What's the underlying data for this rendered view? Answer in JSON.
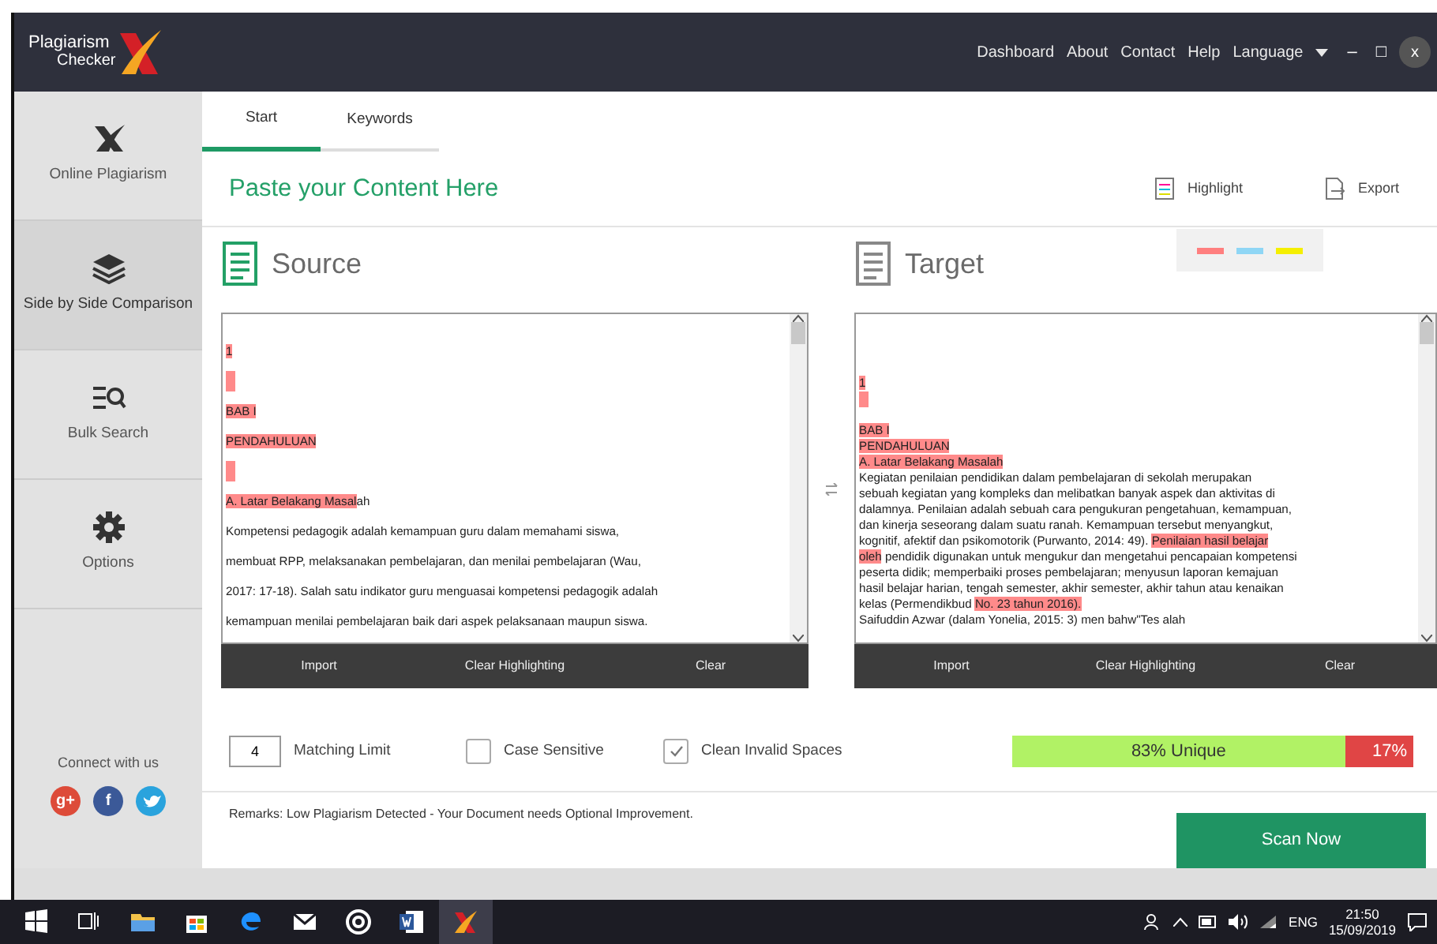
{
  "window": {
    "logo": [
      "Plagiarism",
      "Checker"
    ],
    "nav": [
      "Dashboard",
      "About",
      "Contact",
      "Help",
      "Language"
    ],
    "controls": [
      "–",
      "□",
      "x"
    ]
  },
  "sidebar": {
    "items": [
      {
        "label": "Online Plagiarism",
        "kind": "x",
        "selected": false
      },
      {
        "label": "Side by Side Comparison",
        "kind": "layers",
        "selected": true
      },
      {
        "label": "Bulk Search",
        "kind": "search-list",
        "selected": false
      },
      {
        "label": "Options",
        "kind": "gear",
        "selected": false
      }
    ],
    "connect": "Connect with us",
    "social": [
      {
        "kind": "glyph",
        "glyph": "g+",
        "color": "#dd4b39"
      },
      {
        "kind": "glyph",
        "glyph": "f",
        "color": "#3b5998"
      },
      {
        "kind": "bird",
        "color": "#2aa3dd"
      }
    ]
  },
  "tabs": [
    {
      "label": "Start",
      "selected": true
    },
    {
      "label": "Keywords",
      "selected": false
    }
  ],
  "heading": "Paste your Content Here",
  "tools": [
    "Highlight",
    "Export"
  ],
  "legend": [
    {
      "color": "#ff7f7f"
    },
    {
      "color": "#8fd6f5"
    },
    {
      "color": "#f5ef00"
    }
  ],
  "panels": [
    {
      "title": "Source",
      "kind": "source",
      "buttons": [
        "Import",
        "Clear Highlighting",
        "Clear"
      ],
      "lines": [
        {
          "kind": "text",
          "segments": [
            {
              "text": "1",
              "highlighted": true
            }
          ]
        },
        {
          "kind": "blank",
          "highlighted": true
        },
        {
          "kind": "text",
          "segments": [
            {
              "text": "BAB I ",
              "highlighted": true
            }
          ]
        },
        {
          "kind": "text",
          "segments": [
            {
              "text": "PENDAHULUAN ",
              "highlighted": true
            }
          ]
        },
        {
          "kind": "blank",
          "highlighted": true
        },
        {
          "kind": "text",
          "segments": [
            {
              "text": "A.  Latar Belakang Masal",
              "highlighted": true
            },
            {
              "text": "ah",
              "highlighted": false
            }
          ]
        },
        {
          "kind": "text",
          "segments": [
            {
              "text": "Kompetensi pedagogik adalah kemampuan guru dalam memahami siswa,",
              "highlighted": false
            }
          ]
        },
        {
          "kind": "text",
          "segments": [
            {
              "text": "membuat RPP, melaksanakan pembelajaran, dan menilai pembelajaran (Wau,",
              "highlighted": false
            }
          ]
        },
        {
          "kind": "text",
          "segments": [
            {
              "text": "2017: 17-18). Salah satu indikator guru menguasai kompetensi pedagogik adalah",
              "highlighted": false
            }
          ]
        },
        {
          "kind": "text",
          "segments": [
            {
              "text": "kemampuan menilai pembelajaran baik dari aspek pelaksanaan maupun siswa.",
              "highlighted": false
            }
          ]
        }
      ]
    },
    {
      "title": "Target",
      "kind": "target",
      "buttons": [
        "Import",
        "Clear Highlighting",
        "Clear"
      ],
      "lines": [
        {
          "kind": "text",
          "segments": [
            {
              "text": "1",
              "highlighted": true
            }
          ]
        },
        {
          "kind": "blank",
          "highlighted": true
        },
        {
          "kind": "blank",
          "highlighted": false
        },
        {
          "kind": "text",
          "segments": [
            {
              "text": "BAB I ",
              "highlighted": true
            }
          ]
        },
        {
          "kind": "text",
          "segments": [
            {
              "text": "PENDAHULUAN ",
              "highlighted": true
            }
          ]
        },
        {
          "kind": "text",
          "segments": [
            {
              "text": "A.  Latar Belakang Masalah",
              "highlighted": true
            }
          ]
        },
        {
          "kind": "text",
          "segments": [
            {
              "text": "Kegiatan penilaian pendidikan dalam pembelajaran di sekolah merupakan",
              "highlighted": false
            }
          ]
        },
        {
          "kind": "text",
          "segments": [
            {
              "text": "sebuah kegiatan yang kompleks dan melibatkan banyak aspek dan aktivitas di",
              "highlighted": false
            }
          ]
        },
        {
          "kind": "text",
          "segments": [
            {
              "text": "dalamnya.  Penilaian adalah sebuah cara pengukuran pengetahuan, kemampuan,",
              "highlighted": false
            }
          ]
        },
        {
          "kind": "text",
          "segments": [
            {
              "text": "dan kinerja seseorang dalam suatu ranah.  Kemampuan tersebut menyangkut,",
              "highlighted": false
            }
          ]
        },
        {
          "kind": "text",
          "segments": [
            {
              "text": "kognitif, afektif dan psikomotorik (Purwanto, 2014: 49). ",
              "highlighted": false
            },
            {
              "text": "Penilaian hasil belajar ",
              "highlighted": true
            }
          ]
        },
        {
          "kind": "text",
          "segments": [
            {
              "text": "oleh",
              "highlighted": true
            },
            {
              "text": " pendidik digunakan untuk mengukur dan mengetahui pencapaian kompetensi",
              "highlighted": false
            }
          ]
        },
        {
          "kind": "text",
          "segments": [
            {
              "text": "peserta didik; memperbaiki proses pembelajaran; menyusun laporan kemajuan",
              "highlighted": false
            }
          ]
        },
        {
          "kind": "text",
          "segments": [
            {
              "text": "hasil belajar harian, tengah semester, akhir semester, akhir tahun atau kenaikan",
              "highlighted": false
            }
          ]
        },
        {
          "kind": "text",
          "segments": [
            {
              "text": "kelas (Permendikbud ",
              "highlighted": false
            },
            {
              "text": "No. 23 tahun 2016).",
              "highlighted": true
            }
          ]
        },
        {
          "kind": "text",
          "segments": [
            {
              "text": "Saifuddin Azwar (dalam Yonelia,  2015: 3)  men bahw\"Tes alah",
              "highlighted": false
            }
          ]
        }
      ]
    }
  ],
  "options": {
    "limit_value": "4",
    "limit_label": "Matching Limit",
    "checkboxes": [
      {
        "label": "Case Sensitive",
        "checked": false
      },
      {
        "label": "Clean Invalid Spaces",
        "checked": true
      }
    ]
  },
  "result": {
    "unique_label": "83% Unique",
    "level": 0.83,
    "plagiarism_label": "17%"
  },
  "remarks": "Remarks: Low Plagiarism Detected - Your Document needs Optional Improvement.",
  "scan_button": "Scan Now",
  "taskbar": {
    "language": "ENG",
    "time": "21:50",
    "date": "15/09/2019"
  }
}
